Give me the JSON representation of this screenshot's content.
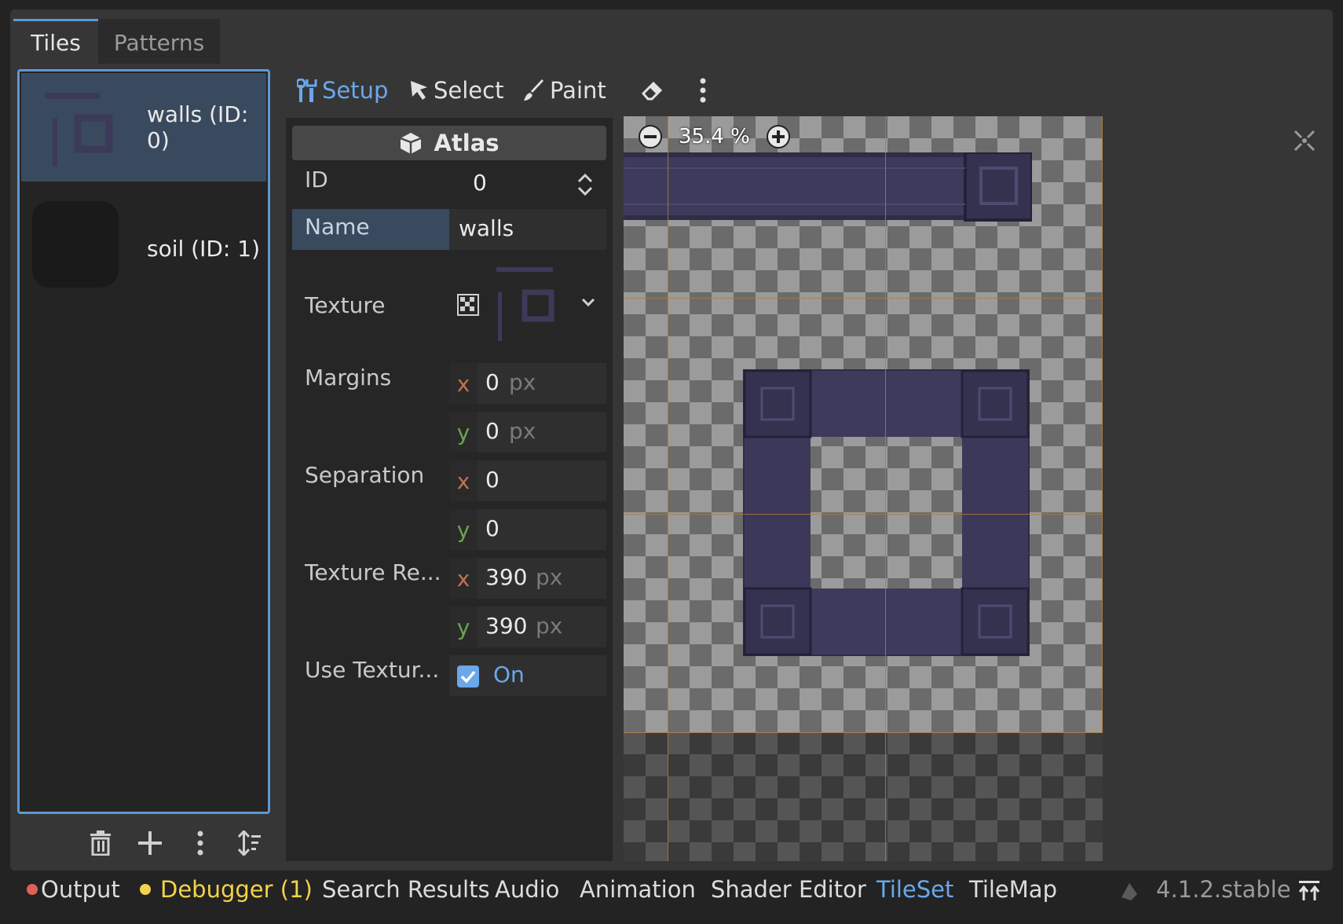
{
  "tabs": [
    {
      "label": "Tiles",
      "active": true
    },
    {
      "label": "Patterns",
      "active": false
    }
  ],
  "sources": [
    {
      "label": "walls (ID: 0)",
      "selected": true,
      "thumb_icon": "walls-texture-thumbnail"
    },
    {
      "label": "soil (ID: 1)",
      "selected": false,
      "thumb_icon": "soil-texture-thumbnail"
    }
  ],
  "list_toolbar": {
    "delete_icon": "trash-icon",
    "add_icon": "plus-icon",
    "menu_icon": "kebab-menu-icon",
    "sort_icon": "sort-icon"
  },
  "modes": {
    "setup": "Setup",
    "select": "Select",
    "paint": "Paint",
    "eraser_icon": "eraser-icon",
    "more_icon": "kebab-menu-icon",
    "active": "Setup"
  },
  "inspector": {
    "header": "Atlas",
    "id_label": "ID",
    "id_value": "0",
    "name_label": "Name",
    "name_value": "walls",
    "texture_label": "Texture",
    "margins_label": "Margins",
    "margins": {
      "x": "0",
      "y": "0",
      "unit": "px"
    },
    "separation_label": "Separation",
    "separation": {
      "x": "0",
      "y": "0"
    },
    "texture_region_label": "Texture Re...",
    "texture_region": {
      "x": "390",
      "y": "390",
      "unit": "px"
    },
    "use_texture_label": "Use Textur...",
    "use_texture_value": "On",
    "use_texture_checked": true
  },
  "viewport": {
    "zoom": "35.4 %",
    "zoom_out_icon": "zoom-out-icon",
    "zoom_in_icon": "zoom-in-icon",
    "center_icon": "center-view-icon"
  },
  "bottom_panel": {
    "output": "Output",
    "debugger": "Debugger (1)",
    "search_results": "Search Results",
    "audio": "Audio",
    "animation": "Animation",
    "shader_editor": "Shader Editor",
    "tileset": "TileSet",
    "tilemap": "TileMap",
    "version": "4.1.2.stable",
    "active": "TileSet"
  },
  "colors": {
    "accent": "#6aa8ea",
    "error_dot": "#e0605a",
    "warning_dot": "#f2d34b",
    "axis_x": "#c0724e",
    "axis_y": "#6aa450"
  }
}
